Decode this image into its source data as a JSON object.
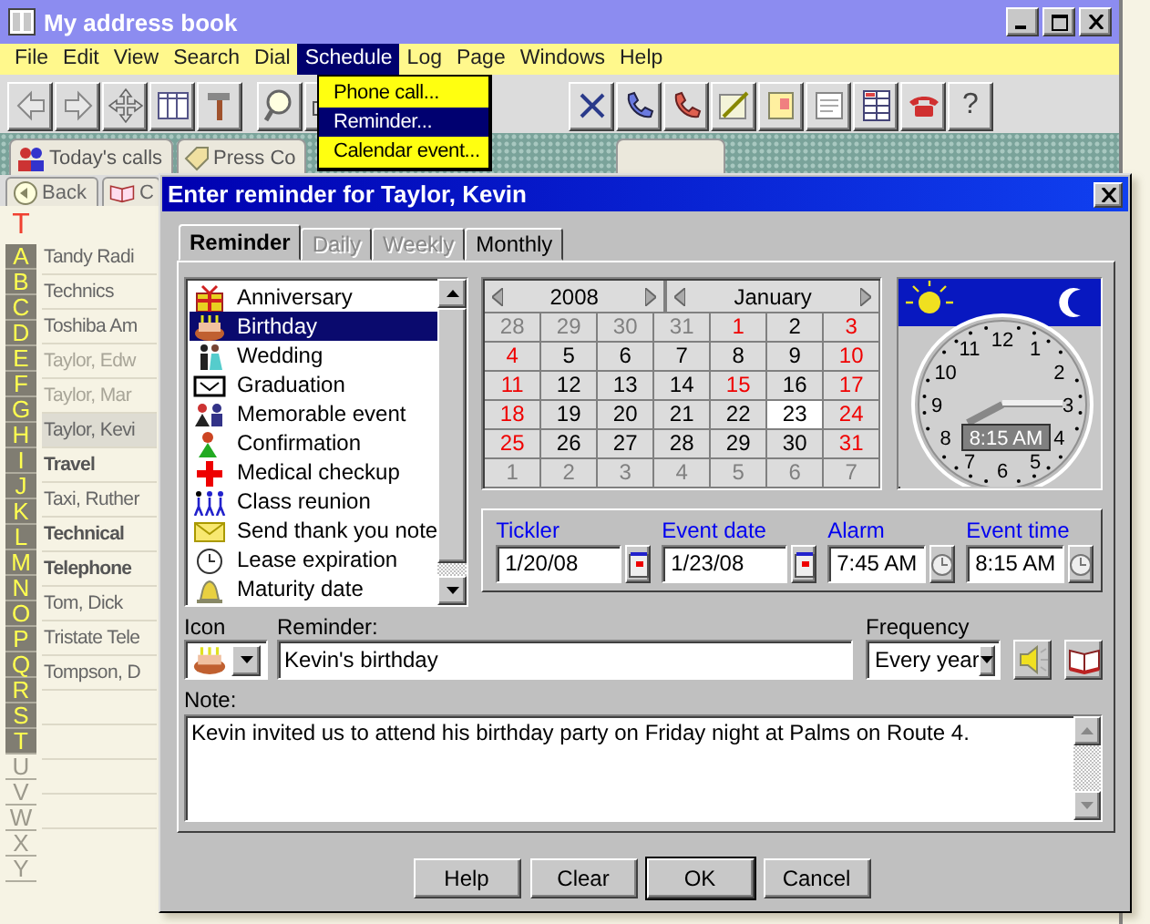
{
  "window": {
    "title": "My address book"
  },
  "menu": [
    {
      "label": "File",
      "selected": false
    },
    {
      "label": "Edit",
      "selected": false
    },
    {
      "label": "View",
      "selected": false
    },
    {
      "label": "Search",
      "selected": false
    },
    {
      "label": "Dial",
      "selected": false
    },
    {
      "label": "Schedule",
      "selected": true
    },
    {
      "label": "Log",
      "selected": false
    },
    {
      "label": "Page",
      "selected": false
    },
    {
      "label": "Windows",
      "selected": false
    },
    {
      "label": "Help",
      "selected": false
    }
  ],
  "schedule_menu": [
    {
      "label": "Phone call...",
      "selected": false
    },
    {
      "label": "Reminder...",
      "selected": true
    },
    {
      "label": "Calendar event...",
      "selected": false
    }
  ],
  "toolbar_help": "?",
  "view_tabs": [
    {
      "label": "Today's calls"
    },
    {
      "label": "Press Co"
    }
  ],
  "nav_tabs": [
    {
      "label": "Back"
    },
    {
      "label": "C"
    }
  ],
  "index": {
    "heading": "T",
    "letters": [
      {
        "letter": "A",
        "enabled": true
      },
      {
        "letter": "B",
        "enabled": true
      },
      {
        "letter": "C",
        "enabled": true
      },
      {
        "letter": "D",
        "enabled": true
      },
      {
        "letter": "E",
        "enabled": true
      },
      {
        "letter": "F",
        "enabled": true
      },
      {
        "letter": "G",
        "enabled": true
      },
      {
        "letter": "H",
        "enabled": true
      },
      {
        "letter": "I",
        "enabled": true
      },
      {
        "letter": "J",
        "enabled": true
      },
      {
        "letter": "K",
        "enabled": true
      },
      {
        "letter": "L",
        "enabled": true
      },
      {
        "letter": "M",
        "enabled": true
      },
      {
        "letter": "N",
        "enabled": true
      },
      {
        "letter": "O",
        "enabled": true
      },
      {
        "letter": "P",
        "enabled": true
      },
      {
        "letter": "Q",
        "enabled": true
      },
      {
        "letter": "R",
        "enabled": true
      },
      {
        "letter": "S",
        "enabled": true
      },
      {
        "letter": "T",
        "enabled": true
      },
      {
        "letter": "U",
        "enabled": false
      },
      {
        "letter": "V",
        "enabled": false
      },
      {
        "letter": "W",
        "enabled": false
      },
      {
        "letter": "X",
        "enabled": false
      },
      {
        "letter": "Y",
        "enabled": false
      }
    ]
  },
  "contacts": [
    {
      "name": "Tandy Radi",
      "kind": "contact",
      "dimmed": false,
      "selected": false
    },
    {
      "name": "Technics",
      "kind": "contact",
      "dimmed": false,
      "selected": false
    },
    {
      "name": "Toshiba Am",
      "kind": "contact",
      "dimmed": false,
      "selected": false
    },
    {
      "name": "Taylor, Edw",
      "kind": "contact",
      "dimmed": true,
      "selected": false
    },
    {
      "name": "Taylor, Mar",
      "kind": "contact",
      "dimmed": true,
      "selected": false
    },
    {
      "name": "Taylor, Kevi",
      "kind": "contact",
      "dimmed": false,
      "selected": true
    },
    {
      "name": "Travel",
      "kind": "group",
      "dimmed": false,
      "selected": false
    },
    {
      "name": "Taxi, Ruther",
      "kind": "contact",
      "dimmed": false,
      "selected": false
    },
    {
      "name": "Technical",
      "kind": "group",
      "dimmed": false,
      "selected": false
    },
    {
      "name": "Telephone",
      "kind": "group",
      "dimmed": false,
      "selected": false
    },
    {
      "name": "Tom, Dick",
      "kind": "contact",
      "dimmed": false,
      "selected": false
    },
    {
      "name": "Tristate Tele",
      "kind": "contact",
      "dimmed": false,
      "selected": false
    },
    {
      "name": "Tompson, D",
      "kind": "contact",
      "dimmed": false,
      "selected": false
    }
  ],
  "dialog": {
    "title": "Enter reminder for Taylor, Kevin",
    "tabs": [
      {
        "label": "Reminder",
        "selected": true,
        "disabled": false
      },
      {
        "label": "Daily",
        "selected": false,
        "disabled": true
      },
      {
        "label": "Weekly",
        "selected": false,
        "disabled": true
      },
      {
        "label": "Monthly",
        "selected": false,
        "disabled": false
      }
    ],
    "occasions": [
      {
        "label": "Anniversary",
        "selected": false
      },
      {
        "label": "Birthday",
        "selected": true
      },
      {
        "label": "Wedding",
        "selected": false
      },
      {
        "label": "Graduation",
        "selected": false
      },
      {
        "label": "Memorable event",
        "selected": false
      },
      {
        "label": "Confirmation",
        "selected": false
      },
      {
        "label": "Medical checkup",
        "selected": false
      },
      {
        "label": "Class reunion",
        "selected": false
      },
      {
        "label": "Send thank you note",
        "selected": false
      },
      {
        "label": "Lease expiration",
        "selected": false
      },
      {
        "label": "Maturity date",
        "selected": false
      }
    ],
    "calendar": {
      "year": "2008",
      "month": "January",
      "days": [
        {
          "d": "28",
          "kind": "outside",
          "selected": false
        },
        {
          "d": "29",
          "kind": "outside",
          "selected": false
        },
        {
          "d": "30",
          "kind": "outside",
          "selected": false
        },
        {
          "d": "31",
          "kind": "outside",
          "selected": false
        },
        {
          "d": "1",
          "kind": "red",
          "selected": false
        },
        {
          "d": "2",
          "kind": "plain",
          "selected": false
        },
        {
          "d": "3",
          "kind": "red",
          "selected": false
        },
        {
          "d": "4",
          "kind": "red",
          "selected": false
        },
        {
          "d": "5",
          "kind": "plain",
          "selected": false
        },
        {
          "d": "6",
          "kind": "plain",
          "selected": false
        },
        {
          "d": "7",
          "kind": "plain",
          "selected": false
        },
        {
          "d": "8",
          "kind": "plain",
          "selected": false
        },
        {
          "d": "9",
          "kind": "plain",
          "selected": false
        },
        {
          "d": "10",
          "kind": "red",
          "selected": false
        },
        {
          "d": "11",
          "kind": "red",
          "selected": false
        },
        {
          "d": "12",
          "kind": "plain",
          "selected": false
        },
        {
          "d": "13",
          "kind": "plain",
          "selected": false
        },
        {
          "d": "14",
          "kind": "plain",
          "selected": false
        },
        {
          "d": "15",
          "kind": "red",
          "selected": false
        },
        {
          "d": "16",
          "kind": "plain",
          "selected": false
        },
        {
          "d": "17",
          "kind": "red",
          "selected": false
        },
        {
          "d": "18",
          "kind": "red",
          "selected": false
        },
        {
          "d": "19",
          "kind": "plain",
          "selected": false
        },
        {
          "d": "20",
          "kind": "plain",
          "selected": false
        },
        {
          "d": "21",
          "kind": "plain",
          "selected": false
        },
        {
          "d": "22",
          "kind": "plain",
          "selected": false
        },
        {
          "d": "23",
          "kind": "plain",
          "selected": true
        },
        {
          "d": "24",
          "kind": "red",
          "selected": false
        },
        {
          "d": "25",
          "kind": "red",
          "selected": false
        },
        {
          "d": "26",
          "kind": "plain",
          "selected": false
        },
        {
          "d": "27",
          "kind": "plain",
          "selected": false
        },
        {
          "d": "28",
          "kind": "plain",
          "selected": false
        },
        {
          "d": "29",
          "kind": "plain",
          "selected": false
        },
        {
          "d": "30",
          "kind": "plain",
          "selected": false
        },
        {
          "d": "31",
          "kind": "red",
          "selected": false
        },
        {
          "d": "1",
          "kind": "outside",
          "selected": false
        },
        {
          "d": "2",
          "kind": "outside",
          "selected": false
        },
        {
          "d": "3",
          "kind": "outside",
          "selected": false
        },
        {
          "d": "4",
          "kind": "outside",
          "selected": false
        },
        {
          "d": "5",
          "kind": "outside",
          "selected": false
        },
        {
          "d": "6",
          "kind": "outside",
          "selected": false
        },
        {
          "d": "7",
          "kind": "outside",
          "selected": false
        }
      ]
    },
    "clock": {
      "numerals": [
        "11",
        "12",
        "1",
        "10",
        "2",
        "9",
        "3",
        "8",
        "4",
        "7",
        "6",
        "5"
      ],
      "time": "8:15 AM"
    },
    "fields": [
      {
        "label": "Tickler",
        "value": "1/20/08",
        "kind": "date"
      },
      {
        "label": "Event date",
        "value": "1/23/08",
        "kind": "date"
      },
      {
        "label": "Alarm",
        "value": "7:45 AM",
        "kind": "time"
      },
      {
        "label": "Event time",
        "value": "8:15 AM",
        "kind": "time"
      }
    ],
    "icon_label": "Icon",
    "reminder_label": "Reminder:",
    "reminder": "Kevin's birthday",
    "frequency_label": "Frequency",
    "frequency": "Every year",
    "note_label": "Note:",
    "note": "Kevin invited us to attend his birthday party on Friday night at Palms on Route 4.",
    "buttons": [
      {
        "label": "Help",
        "default": false
      },
      {
        "label": "Clear",
        "default": false
      },
      {
        "label": "OK",
        "default": true
      },
      {
        "label": "Cancel",
        "default": false
      }
    ]
  }
}
